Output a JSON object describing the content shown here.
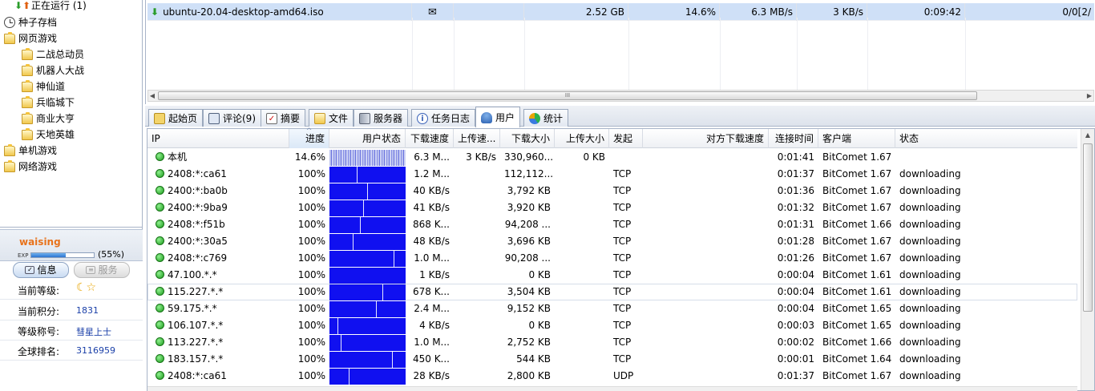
{
  "sidebar": {
    "tree": [
      {
        "label": "正在运行 (1)",
        "icon": "download-upload-icon"
      },
      {
        "label": "种子存档",
        "icon": "clock-icon"
      },
      {
        "label": "网页游戏",
        "icon": "folder-icon"
      },
      {
        "label": "二战总动员",
        "icon": "folder-icon"
      },
      {
        "label": "机器人大战",
        "icon": "folder-icon"
      },
      {
        "label": "神仙道",
        "icon": "folder-icon"
      },
      {
        "label": "兵临城下",
        "icon": "folder-icon"
      },
      {
        "label": "商业大亨",
        "icon": "folder-icon"
      },
      {
        "label": "天地英雄",
        "icon": "folder-icon"
      },
      {
        "label": "单机游戏",
        "icon": "folder-icon"
      },
      {
        "label": "网络游戏",
        "icon": "folder-icon"
      }
    ],
    "profile": {
      "username": "waising",
      "exp_label": "EXP",
      "exp_progress": 0.55,
      "exp_text": "(55%)",
      "info_button": "信息",
      "service_button": "服务",
      "rows": [
        {
          "key": "当前等级:",
          "value": "☾☆"
        },
        {
          "key": "当前积分:",
          "value": "1831"
        },
        {
          "key": "等级称号:",
          "value": "彗星上士"
        },
        {
          "key": "全球排名:",
          "value": "3116959"
        }
      ]
    }
  },
  "task": {
    "name": "ubuntu-20.04-desktop-amd64.iso",
    "size": "2.52 GB",
    "progress": "14.6%",
    "down_speed": "6.3 MB/s",
    "up_speed": "3 KB/s",
    "remaining": "0:09:42",
    "seeds": "0/0[2/"
  },
  "tabs": [
    {
      "label": "起始页",
      "icon": "start-page-icon"
    },
    {
      "label": "评论(9)",
      "icon": "comments-icon"
    },
    {
      "label": "摘要",
      "icon": "summary-icon"
    },
    {
      "label": "文件",
      "icon": "files-icon"
    },
    {
      "label": "服务器",
      "icon": "server-icon"
    },
    {
      "label": "任务日志",
      "icon": "log-icon"
    },
    {
      "label": "用户",
      "icon": "users-icon"
    },
    {
      "label": "统计",
      "icon": "stats-icon"
    }
  ],
  "active_tab": "用户",
  "peers": {
    "columns": [
      "IP",
      "进度",
      "用户状态",
      "下载速度",
      "上传速...",
      "下载大小",
      "上传大小",
      "发起",
      "对方下载速度",
      "连接时间",
      "客户端",
      "状态"
    ],
    "rows": [
      {
        "ip": "本机",
        "progress": "14.6%",
        "down": "6.3 M...",
        "up": "3 KB/s",
        "dl_size": "330,960...",
        "ul_size": "0 KB",
        "init": "",
        "peer_speed": "",
        "time": "0:01:41",
        "client": "BitComet 1.67",
        "state": ""
      },
      {
        "ip": "2408:*:ca61",
        "progress": "100%",
        "down": "1.2 M...",
        "up": "",
        "dl_size": "112,112...",
        "ul_size": "",
        "init": "TCP",
        "peer_speed": "",
        "time": "0:01:37",
        "client": "BitComet 1.67",
        "state": "downloading"
      },
      {
        "ip": "2400:*:ba0b",
        "progress": "100%",
        "down": "40 KB/s",
        "up": "",
        "dl_size": "3,792 KB",
        "ul_size": "",
        "init": "TCP",
        "peer_speed": "",
        "time": "0:01:36",
        "client": "BitComet 1.67",
        "state": "downloading"
      },
      {
        "ip": "2400:*:9ba9",
        "progress": "100%",
        "down": "41 KB/s",
        "up": "",
        "dl_size": "3,920 KB",
        "ul_size": "",
        "init": "TCP",
        "peer_speed": "",
        "time": "0:01:32",
        "client": "BitComet 1.67",
        "state": "downloading"
      },
      {
        "ip": "2408:*:f51b",
        "progress": "100%",
        "down": "868 K...",
        "up": "",
        "dl_size": "94,208 ...",
        "ul_size": "",
        "init": "TCP",
        "peer_speed": "",
        "time": "0:01:31",
        "client": "BitComet 1.66",
        "state": "downloading"
      },
      {
        "ip": "2400:*:30a5",
        "progress": "100%",
        "down": "48 KB/s",
        "up": "",
        "dl_size": "3,696 KB",
        "ul_size": "",
        "init": "TCP",
        "peer_speed": "",
        "time": "0:01:28",
        "client": "BitComet 1.67",
        "state": "downloading"
      },
      {
        "ip": "2408:*:c769",
        "progress": "100%",
        "down": "1.0 M...",
        "up": "",
        "dl_size": "90,208 ...",
        "ul_size": "",
        "init": "TCP",
        "peer_speed": "",
        "time": "0:01:26",
        "client": "BitComet 1.67",
        "state": "downloading"
      },
      {
        "ip": "47.100.*.*",
        "progress": "100%",
        "down": "1 KB/s",
        "up": "",
        "dl_size": "0 KB",
        "ul_size": "",
        "init": "TCP",
        "peer_speed": "",
        "time": "0:00:04",
        "client": "BitComet 1.61",
        "state": "downloading"
      },
      {
        "ip": "115.227.*.*",
        "progress": "100%",
        "down": "678 K...",
        "up": "",
        "dl_size": "3,504 KB",
        "ul_size": "",
        "init": "TCP",
        "peer_speed": "",
        "time": "0:00:04",
        "client": "BitComet 1.61",
        "state": "downloading"
      },
      {
        "ip": "59.175.*.*",
        "progress": "100%",
        "down": "2.4 M...",
        "up": "",
        "dl_size": "9,152 KB",
        "ul_size": "",
        "init": "TCP",
        "peer_speed": "",
        "time": "0:00:04",
        "client": "BitComet 1.65",
        "state": "downloading"
      },
      {
        "ip": "106.107.*.*",
        "progress": "100%",
        "down": "4 KB/s",
        "up": "",
        "dl_size": "0 KB",
        "ul_size": "",
        "init": "TCP",
        "peer_speed": "",
        "time": "0:00:03",
        "client": "BitComet 1.65",
        "state": "downloading"
      },
      {
        "ip": "113.227.*.*",
        "progress": "100%",
        "down": "1.0 M...",
        "up": "",
        "dl_size": "2,752 KB",
        "ul_size": "",
        "init": "TCP",
        "peer_speed": "",
        "time": "0:00:02",
        "client": "BitComet 1.66",
        "state": "downloading"
      },
      {
        "ip": "183.157.*.*",
        "progress": "100%",
        "down": "450 K...",
        "up": "",
        "dl_size": "544 KB",
        "ul_size": "",
        "init": "TCP",
        "peer_speed": "",
        "time": "0:00:01",
        "client": "BitComet 1.64",
        "state": "downloading"
      },
      {
        "ip": "2408:*:ca61",
        "progress": "100%",
        "down": "28 KB/s",
        "up": "",
        "dl_size": "2,800 KB",
        "ul_size": "",
        "init": "UDP",
        "peer_speed": "",
        "time": "0:01:37",
        "client": "BitComet 1.67",
        "state": "downloading"
      }
    ]
  }
}
